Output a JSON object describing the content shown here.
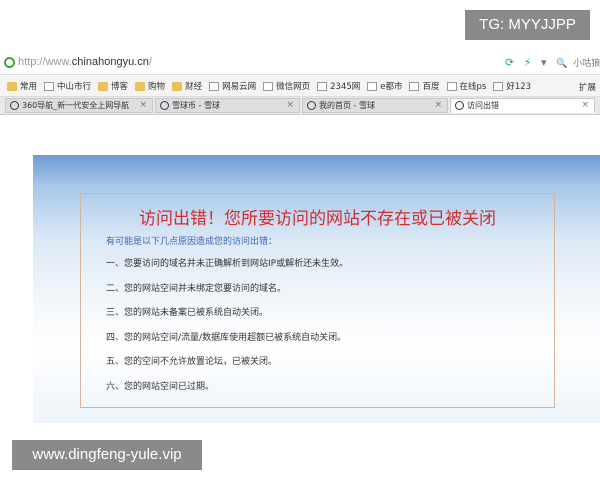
{
  "tg_badge": "TG: MYYJJPP",
  "address_bar": {
    "url_prefix": "http://www.",
    "url_domain": "chinahongyu.cn",
    "url_suffix": "/",
    "right_text": "小咕狼"
  },
  "bookmarks": [
    {
      "label": "常用",
      "icon": "folder"
    },
    {
      "label": "中山市行",
      "icon": "page"
    },
    {
      "label": "博客",
      "icon": "folder"
    },
    {
      "label": "购物",
      "icon": "folder"
    },
    {
      "label": "财经",
      "icon": "folder"
    },
    {
      "label": "网易云网",
      "icon": "page"
    },
    {
      "label": "微信网页",
      "icon": "page"
    },
    {
      "label": "2345网",
      "icon": "page"
    },
    {
      "label": "e都市",
      "icon": "page"
    },
    {
      "label": "百度",
      "icon": "page"
    },
    {
      "label": "在线ps",
      "icon": "page"
    },
    {
      "label": "好123",
      "icon": "page"
    }
  ],
  "bookmarks_right": "扩展",
  "tabs": [
    {
      "label": "360导航_新一代安全上网导航",
      "active": false
    },
    {
      "label": "雪球币 - 雪球",
      "active": false
    },
    {
      "label": "我的首页 - 雪球",
      "active": false
    },
    {
      "label": "访问出错",
      "active": true
    }
  ],
  "error": {
    "title": "访问出错！您所要访问的网站不存在或已被关闭",
    "subtitle": "有可能是以下几点原因造成您的访问出错：",
    "reasons": [
      "一、您要访问的域名并未正确解析到网站IP或解析还未生效。",
      "二、您的网站空间并未绑定您要访问的域名。",
      "三、您的网站未备案已被系统自动关闭。",
      "四、您的网站空间/流量/数据库使用超额已被系统自动关闭。",
      "五、您的空间不允许放置论坛，已被关闭。",
      "六、您的网站空间已过期。"
    ]
  },
  "watermark": "www.dingfeng-yule.vip",
  "colors": {
    "error_title": "#d12d2d",
    "subtitle": "#3a66b5",
    "box_border": "#d3b49a"
  }
}
